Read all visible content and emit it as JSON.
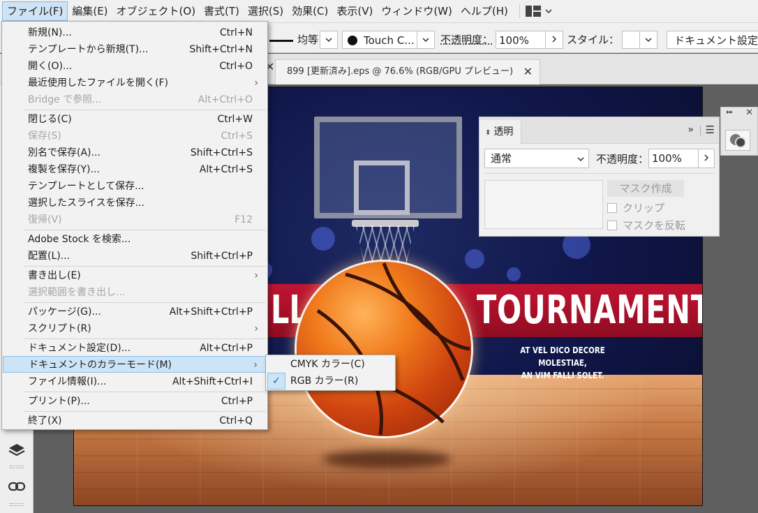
{
  "menubar": {
    "items": [
      "ファイル(F)",
      "編集(E)",
      "オブジェクト(O)",
      "書式(T)",
      "選択(S)",
      "効果(C)",
      "表示(V)",
      "ウィンドウ(W)",
      "ヘルプ(H)"
    ]
  },
  "controlbar": {
    "stroke_profile": "均等",
    "brush": "Touch C...",
    "opacity_label": "不透明度：",
    "opacity_value": "100%",
    "style_label": "スタイル：",
    "doc_setup_button": "ドキュメント設定"
  },
  "document_tab": {
    "title": "899 [更新済み].eps @ 76.6% (RGB/GPU プレビュー)"
  },
  "artwork": {
    "title_left": "LL",
    "title_right": "TOURNAMENT",
    "subtitle_line1": "AT VEL DICO DECORE MOLESTIAE,",
    "subtitle_line2": "AN VIM FALLI SOLET."
  },
  "transparency_panel": {
    "tab_label": "透明",
    "blend_mode": "通常",
    "opacity_label": "不透明度：",
    "opacity_value": "100%",
    "make_mask_button": "マスク作成",
    "clip_label": "クリップ",
    "invert_mask_label": "マスクを反転"
  },
  "file_menu": {
    "items": [
      {
        "label": "新規(N)...",
        "shortcut": "Ctrl+N"
      },
      {
        "label": "テンプレートから新規(T)...",
        "shortcut": "Shift+Ctrl+N"
      },
      {
        "label": "開く(O)...",
        "shortcut": "Ctrl+O"
      },
      {
        "label": "最近使用したファイルを開く(F)",
        "shortcut": ""
      },
      {
        "label": "Bridge で参照...",
        "shortcut": "Alt+Ctrl+O"
      },
      {
        "label": "閉じる(C)",
        "shortcut": "Ctrl+W"
      },
      {
        "label": "保存(S)",
        "shortcut": "Ctrl+S"
      },
      {
        "label": "別名で保存(A)...",
        "shortcut": "Shift+Ctrl+S"
      },
      {
        "label": "複製を保存(Y)...",
        "shortcut": "Alt+Ctrl+S"
      },
      {
        "label": "テンプレートとして保存...",
        "shortcut": ""
      },
      {
        "label": "選択したスライスを保存...",
        "shortcut": ""
      },
      {
        "label": "復帰(V)",
        "shortcut": "F12"
      },
      {
        "label": "Adobe Stock を検索...",
        "shortcut": ""
      },
      {
        "label": "配置(L)...",
        "shortcut": "Shift+Ctrl+P"
      },
      {
        "label": "書き出し(E)",
        "shortcut": ""
      },
      {
        "label": "選択範囲を書き出し...",
        "shortcut": ""
      },
      {
        "label": "パッケージ(G)...",
        "shortcut": "Alt+Shift+Ctrl+P"
      },
      {
        "label": "スクリプト(R)",
        "shortcut": ""
      },
      {
        "label": "ドキュメント設定(D)...",
        "shortcut": "Alt+Ctrl+P"
      },
      {
        "label": "ドキュメントのカラーモード(M)",
        "shortcut": ""
      },
      {
        "label": "ファイル情報(I)...",
        "shortcut": "Alt+Shift+Ctrl+I"
      },
      {
        "label": "プリント(P)...",
        "shortcut": "Ctrl+P"
      },
      {
        "label": "終了(X)",
        "shortcut": "Ctrl+Q"
      }
    ]
  },
  "color_mode_submenu": {
    "items": [
      {
        "label": "CMYK カラー(C)",
        "checked": false
      },
      {
        "label": "RGB カラー(R)",
        "checked": true
      }
    ]
  },
  "colors": {
    "menu_highlight": "#cde4f7",
    "banner_red": "#c11431",
    "ball_orange": "#f07a1c"
  }
}
